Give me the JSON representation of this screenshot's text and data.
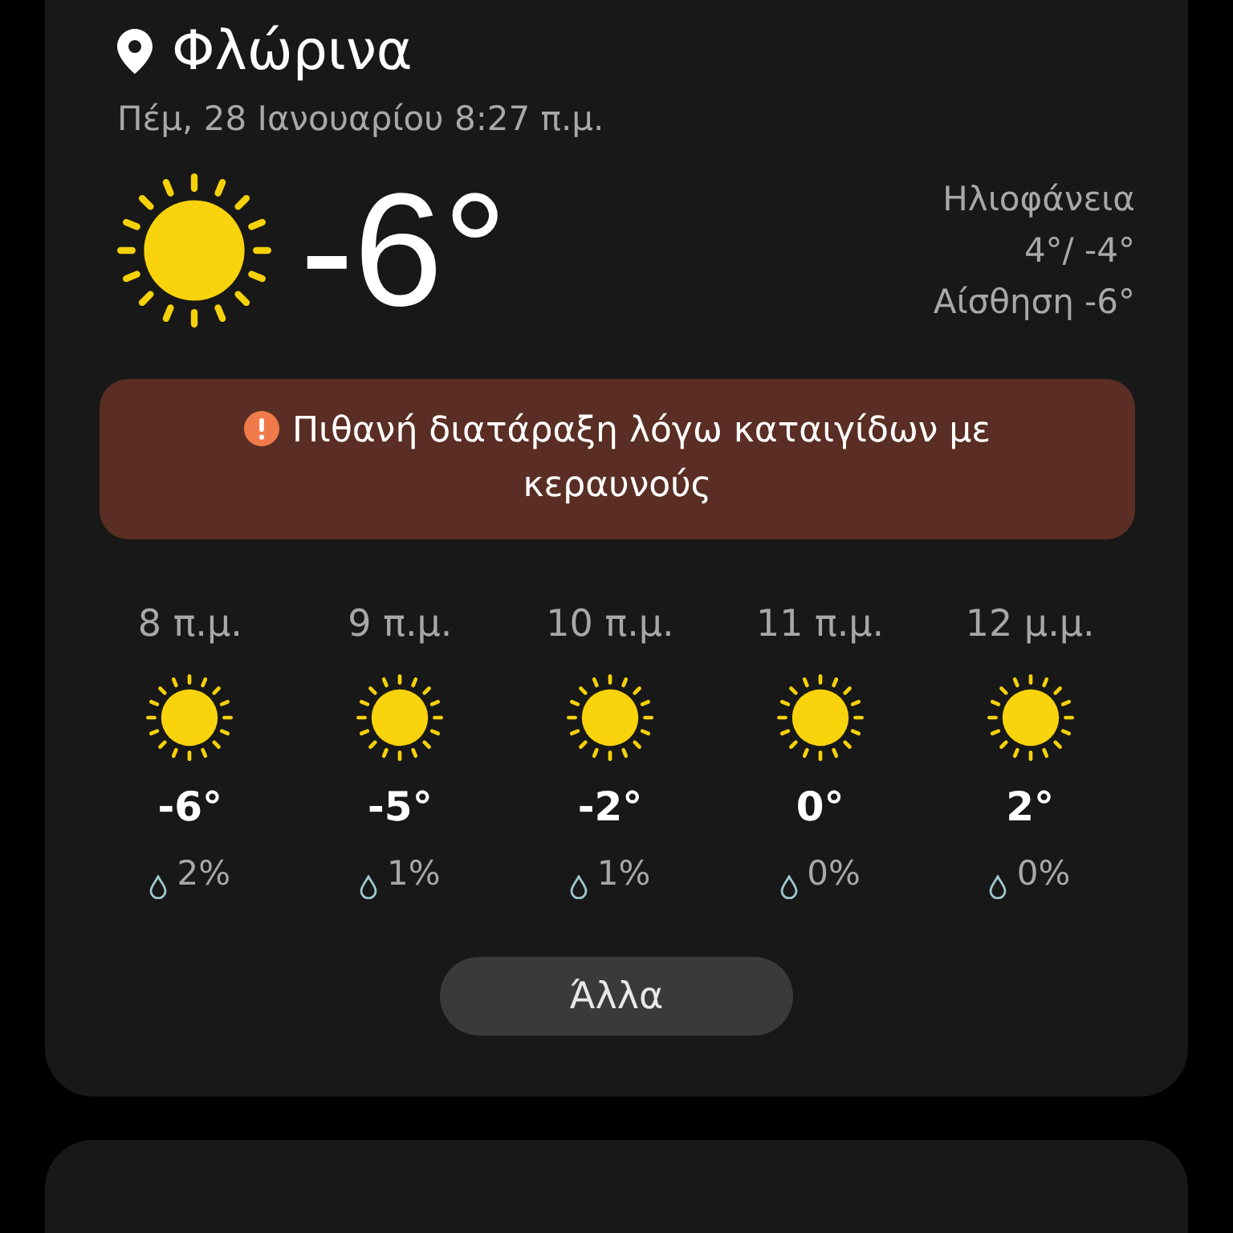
{
  "location": {
    "name": "Φλώρινα",
    "datetime": "Πέμ, 28 Ιανουαρίου 8:27 π.μ."
  },
  "current": {
    "temperature": "-6°",
    "condition": "Ηλιοφάνεια",
    "high_low": "4°/ -4°",
    "feels_like": "Αίσθηση -6°"
  },
  "alert": {
    "text": "Πιθανή διατάραξη λόγω καταιγίδων με κεραυνούς"
  },
  "hourly": [
    {
      "time": "8 π.μ.",
      "temperature": "-6°",
      "precipitation": "2%"
    },
    {
      "time": "9 π.μ.",
      "temperature": "-5°",
      "precipitation": "1%"
    },
    {
      "time": "10 π.μ.",
      "temperature": "-2°",
      "precipitation": "1%"
    },
    {
      "time": "11 π.μ.",
      "temperature": "0°",
      "precipitation": "0%"
    },
    {
      "time": "12 μ.μ.",
      "temperature": "2°",
      "precipitation": "0%"
    }
  ],
  "more_button": {
    "label": "Άλλα"
  }
}
